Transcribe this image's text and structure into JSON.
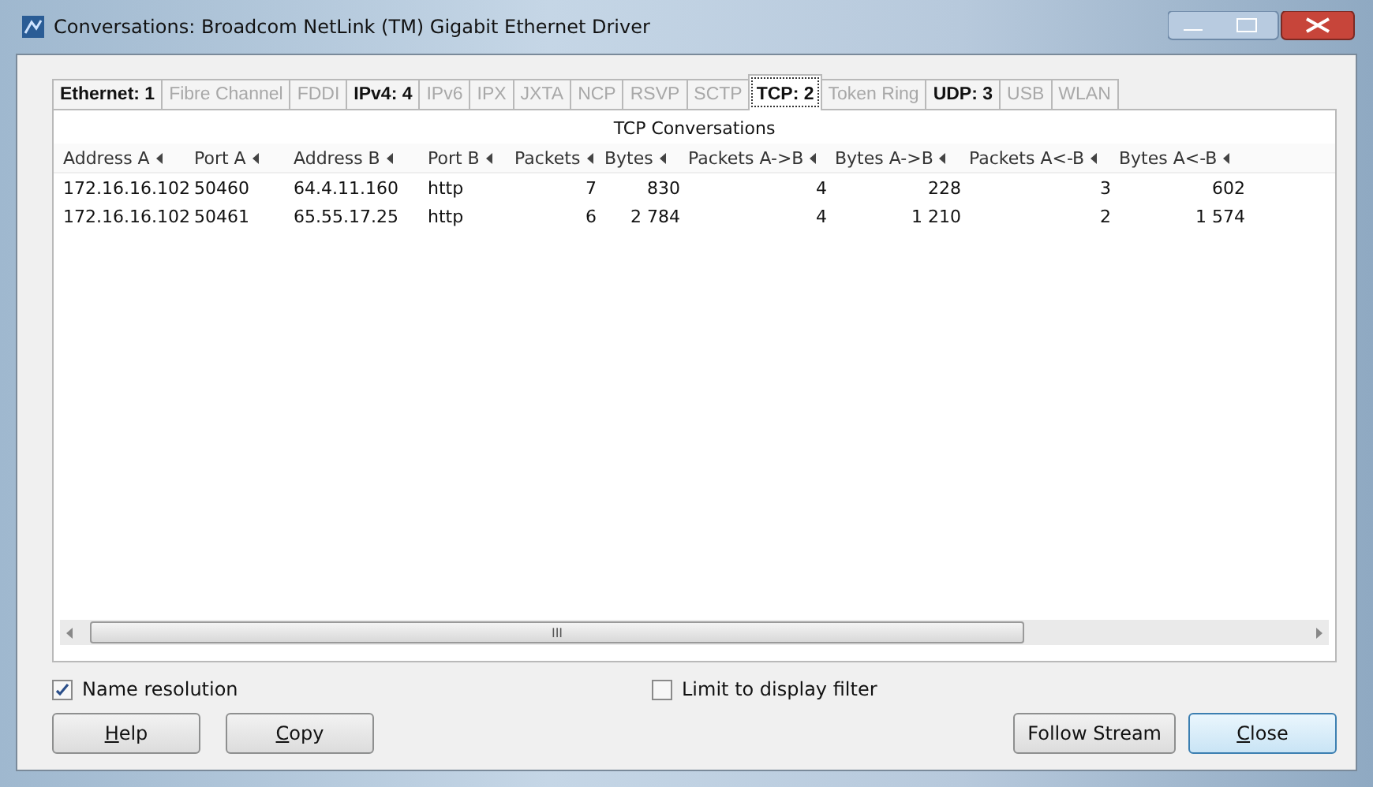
{
  "window": {
    "title": "Conversations: Broadcom NetLink (TM) Gigabit Ethernet Driver"
  },
  "tabs": [
    {
      "label": "Ethernet: 1",
      "disabled": false,
      "selected": false
    },
    {
      "label": "Fibre Channel",
      "disabled": true,
      "selected": false
    },
    {
      "label": "FDDI",
      "disabled": true,
      "selected": false
    },
    {
      "label": "IPv4: 4",
      "disabled": false,
      "selected": false
    },
    {
      "label": "IPv6",
      "disabled": true,
      "selected": false
    },
    {
      "label": "IPX",
      "disabled": true,
      "selected": false
    },
    {
      "label": "JXTA",
      "disabled": true,
      "selected": false
    },
    {
      "label": "NCP",
      "disabled": true,
      "selected": false
    },
    {
      "label": "RSVP",
      "disabled": true,
      "selected": false
    },
    {
      "label": "SCTP",
      "disabled": true,
      "selected": false
    },
    {
      "label": "TCP: 2",
      "disabled": false,
      "selected": true
    },
    {
      "label": "Token Ring",
      "disabled": true,
      "selected": false
    },
    {
      "label": "UDP: 3",
      "disabled": false,
      "selected": false
    },
    {
      "label": "USB",
      "disabled": true,
      "selected": false
    },
    {
      "label": "WLAN",
      "disabled": true,
      "selected": false
    }
  ],
  "table": {
    "title": "TCP Conversations",
    "columns": [
      {
        "label": "Address A",
        "kind": "text"
      },
      {
        "label": "Port A",
        "kind": "text"
      },
      {
        "label": "Address B",
        "kind": "text"
      },
      {
        "label": "Port B",
        "kind": "text"
      },
      {
        "label": "Packets",
        "kind": "number"
      },
      {
        "label": "Bytes",
        "kind": "number"
      },
      {
        "label": "Packets A->B",
        "kind": "number"
      },
      {
        "label": "Bytes A->B",
        "kind": "number"
      },
      {
        "label": "Packets A<-B",
        "kind": "number"
      },
      {
        "label": "Bytes A<-B",
        "kind": "number"
      }
    ],
    "rows": [
      [
        "172.16.16.102",
        "50460",
        "64.4.11.160",
        "http",
        "7",
        "830",
        "4",
        "228",
        "3",
        "602"
      ],
      [
        "172.16.16.102",
        "50461",
        "65.55.17.25",
        "http",
        "6",
        "2 784",
        "4",
        "1 210",
        "2",
        "1 574"
      ]
    ],
    "scrollbar_grip": "III"
  },
  "options": [
    {
      "label": "Name resolution",
      "checked": true
    },
    {
      "label": "Limit to display filter",
      "checked": false
    }
  ],
  "left_buttons": [
    {
      "label": "Help",
      "mnemonic": true
    },
    {
      "label": "Copy",
      "mnemonic": true
    }
  ],
  "right_buttons": [
    {
      "label": "Follow Stream",
      "mnemonic": false,
      "default": false
    },
    {
      "label": "Close",
      "mnemonic": true,
      "default": true
    }
  ]
}
